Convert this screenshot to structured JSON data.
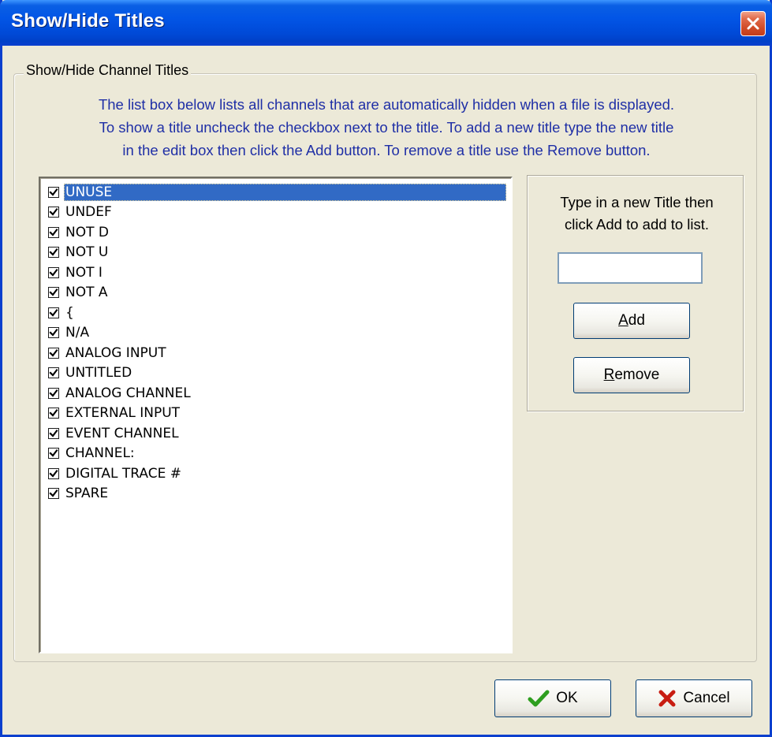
{
  "window": {
    "title": "Show/Hide Titles"
  },
  "group": {
    "legend": "Show/Hide Channel Titles",
    "description": [
      "The list box below lists all channels that are automatically hidden when a file is displayed.",
      "To show a title uncheck the checkbox next to the title. To add a new title type the new title",
      "in the edit box then click the Add button. To remove a title use the Remove button."
    ]
  },
  "list": {
    "items": [
      {
        "label": "UNUSE",
        "checked": true,
        "selected": true
      },
      {
        "label": "UNDEF",
        "checked": true
      },
      {
        "label": "NOT D",
        "checked": true
      },
      {
        "label": "NOT U",
        "checked": true
      },
      {
        "label": "NOT I",
        "checked": true
      },
      {
        "label": "NOT A",
        "checked": true
      },
      {
        "label": "{",
        "checked": true
      },
      {
        "label": "N/A",
        "checked": true
      },
      {
        "label": "ANALOG INPUT",
        "checked": true
      },
      {
        "label": "UNTITLED",
        "checked": true
      },
      {
        "label": "ANALOG CHANNEL",
        "checked": true
      },
      {
        "label": "EXTERNAL INPUT",
        "checked": true
      },
      {
        "label": "EVENT CHANNEL",
        "checked": true
      },
      {
        "label": "CHANNEL:",
        "checked": true
      },
      {
        "label": "DIGITAL TRACE #",
        "checked": true
      },
      {
        "label": "SPARE",
        "checked": true
      }
    ]
  },
  "side": {
    "hint_lines": [
      "Type in a new Title then",
      "click Add to add to list."
    ],
    "input_value": "",
    "add": {
      "mnemonic": "A",
      "rest": "dd"
    },
    "remove": {
      "mnemonic": "R",
      "rest": "emove"
    }
  },
  "footer": {
    "ok_label": "OK",
    "cancel_label": "Cancel"
  },
  "colors": {
    "title_bar": "#0255e6",
    "dialog_bg": "#ece9d8",
    "description_text": "#1f2fa6",
    "selection": "#316ac5",
    "ok_check": "#2e9e1f",
    "cancel_x": "#c81d12"
  }
}
